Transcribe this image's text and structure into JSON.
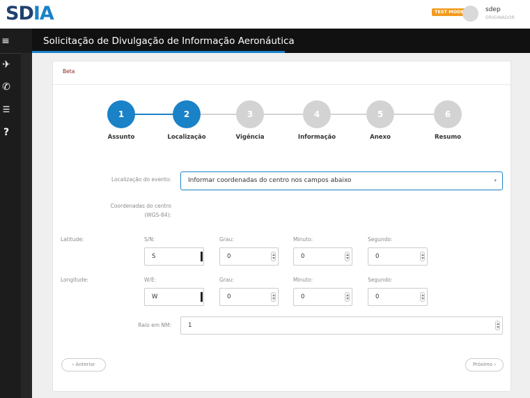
{
  "header": {
    "logo_main": "SD",
    "logo_accent": "IA",
    "test_mode_label": "TEST MODE",
    "user": {
      "name": "sdep",
      "role": "ORIGINADOR"
    }
  },
  "sidebar": {
    "icons": [
      "menu-icon",
      "plane-icon",
      "phone-icon",
      "list-icon",
      "help-icon"
    ],
    "glyphs": {
      "menu": "≡",
      "plane": "✈",
      "phone": "✆",
      "list": "☰",
      "help": "?"
    }
  },
  "page": {
    "title": "Solicitação de Divulgação de Informação Aeronáutica"
  },
  "card": {
    "badge": "Beta"
  },
  "stepper": {
    "colors": {
      "active": "#1a82c7",
      "inactive": "#d3d3d3"
    },
    "steps": [
      {
        "number": "1",
        "label": "Assunto",
        "active": true
      },
      {
        "number": "2",
        "label": "Localização",
        "active": true
      },
      {
        "number": "3",
        "label": "Vigência",
        "active": false
      },
      {
        "number": "4",
        "label": "Informação",
        "active": false
      },
      {
        "number": "5",
        "label": "Anexo",
        "active": false
      },
      {
        "number": "6",
        "label": "Resumo",
        "active": false
      }
    ]
  },
  "form": {
    "location_label": "Localização do evento:",
    "location_value": "Informar coordenadas do centro nos campos abaixo",
    "coords_label_1": "Coordenadas do centro",
    "coords_label_2": "(WGS-84):",
    "latitude": {
      "label": "Latitude:",
      "dir_label": "S/N:",
      "dir_value": "S",
      "deg_label": "Grau:",
      "deg_value": "0",
      "min_label": "Minuto:",
      "min_value": "0",
      "sec_label": "Segundo:",
      "sec_value": "0"
    },
    "longitude": {
      "label": "Longitude:",
      "dir_label": "W/E:",
      "dir_value": "W",
      "deg_label": "Grau:",
      "deg_value": "0",
      "min_label": "Minuto:",
      "min_value": "0",
      "sec_label": "Segundo:",
      "sec_value": "0"
    },
    "radius_label": "Raio em NM:",
    "radius_value": "1"
  },
  "nav": {
    "prev_label": "‹ Anterior",
    "next_label": "Próximo ›"
  }
}
